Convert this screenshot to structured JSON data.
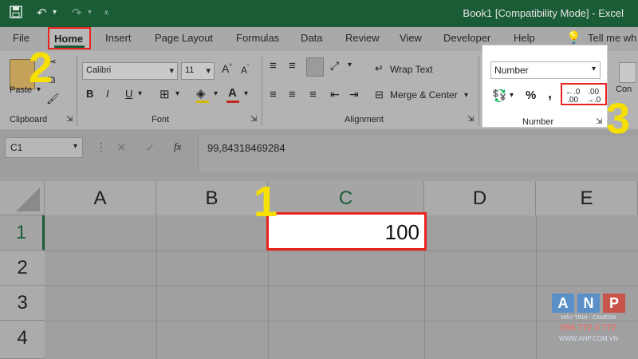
{
  "titlebar": {
    "title": "Book1  [Compatibility Mode]  -  Excel"
  },
  "tabs": [
    "File",
    "Home",
    "Insert",
    "Page Layout",
    "Formulas",
    "Data",
    "Review",
    "View",
    "Developer",
    "Help",
    "Tell me wh"
  ],
  "ribbon": {
    "clipboard": {
      "paste": "Paste",
      "label": "Clipboard"
    },
    "font": {
      "name": "Calibri",
      "size": "11",
      "bold": "B",
      "italic": "I",
      "underline": "U",
      "label": "Font"
    },
    "alignment": {
      "wrap": "Wrap Text",
      "merge": "Merge & Center",
      "label": "Alignment"
    },
    "number": {
      "format": "Number",
      "percent": "%",
      "comma": ",",
      "label": "Number"
    },
    "conditional": "Con"
  },
  "formula_bar": {
    "name_box": "C1",
    "value": "99,84318469284"
  },
  "grid": {
    "columns": [
      "A",
      "B",
      "C",
      "D",
      "E"
    ],
    "rows": [
      "1",
      "2",
      "3",
      "4"
    ],
    "cell_c1": "100"
  },
  "annotations": [
    "1",
    "2",
    "3"
  ],
  "watermark": {
    "brand": [
      "A",
      "N",
      "P"
    ],
    "line1": "MÁY TÍNH - CAMERA",
    "phone": "098 772 0 772",
    "url": "WWW.ANP.COM.VN"
  }
}
